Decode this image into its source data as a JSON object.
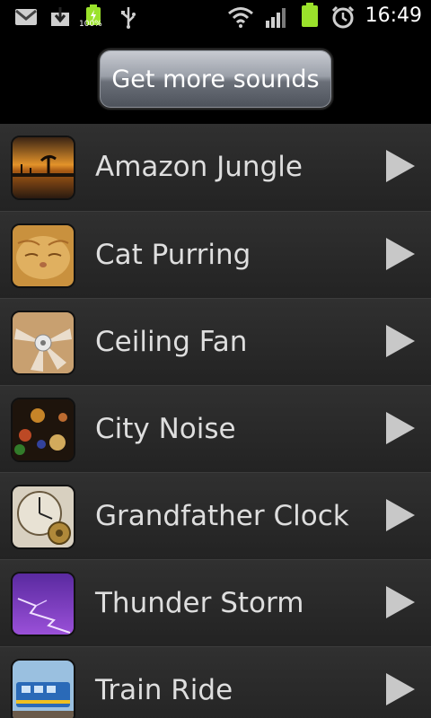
{
  "status_bar": {
    "time": "16:49",
    "battery_percent_label": "100%",
    "icons": [
      "gmail-icon",
      "download-icon",
      "battery-charging-icon",
      "usb-icon",
      "wifi-icon",
      "signal-icon",
      "battery-icon",
      "alarm-clock-icon"
    ]
  },
  "header": {
    "get_more_label": "Get more sounds"
  },
  "sounds": [
    {
      "label": "Amazon Jungle",
      "thumb": "sunset-trees-thumb"
    },
    {
      "label": "Cat Purring",
      "thumb": "sleeping-cat-thumb"
    },
    {
      "label": "Ceiling Fan",
      "thumb": "ceiling-fan-thumb"
    },
    {
      "label": "City Noise",
      "thumb": "city-lights-thumb"
    },
    {
      "label": "Grandfather Clock",
      "thumb": "clock-gears-thumb"
    },
    {
      "label": "Thunder Storm",
      "thumb": "lightning-thumb"
    },
    {
      "label": "Train Ride",
      "thumb": "train-thumb"
    }
  ],
  "colors": {
    "background": "#000000",
    "row_text": "#dedede",
    "play_icon": "#c8c8c8",
    "battery_green": "#9be22b"
  }
}
